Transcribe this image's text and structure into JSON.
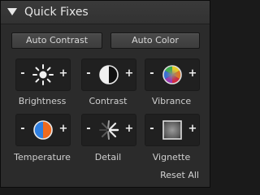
{
  "panel": {
    "title": "Quick Fixes"
  },
  "buttons": {
    "auto_contrast": "Auto Contrast",
    "auto_color": "Auto Color"
  },
  "controls": [
    {
      "label": "Brightness",
      "icon": "sun-icon",
      "minus": "-",
      "plus": "+"
    },
    {
      "label": "Contrast",
      "icon": "contrast-icon",
      "minus": "-",
      "plus": "+"
    },
    {
      "label": "Vibrance",
      "icon": "color-wheel-icon",
      "minus": "-",
      "plus": "+"
    },
    {
      "label": "Temperature",
      "icon": "temperature-icon",
      "minus": "-",
      "plus": "+"
    },
    {
      "label": "Detail",
      "icon": "detail-icon",
      "minus": "-",
      "plus": "+"
    },
    {
      "label": "Vignette",
      "icon": "vignette-icon",
      "minus": "-",
      "plus": "+"
    }
  ],
  "footer": {
    "reset_all": "Reset All"
  },
  "colors": {
    "temperature_warm": "#f06a1e",
    "temperature_cool": "#2f7fe0"
  }
}
